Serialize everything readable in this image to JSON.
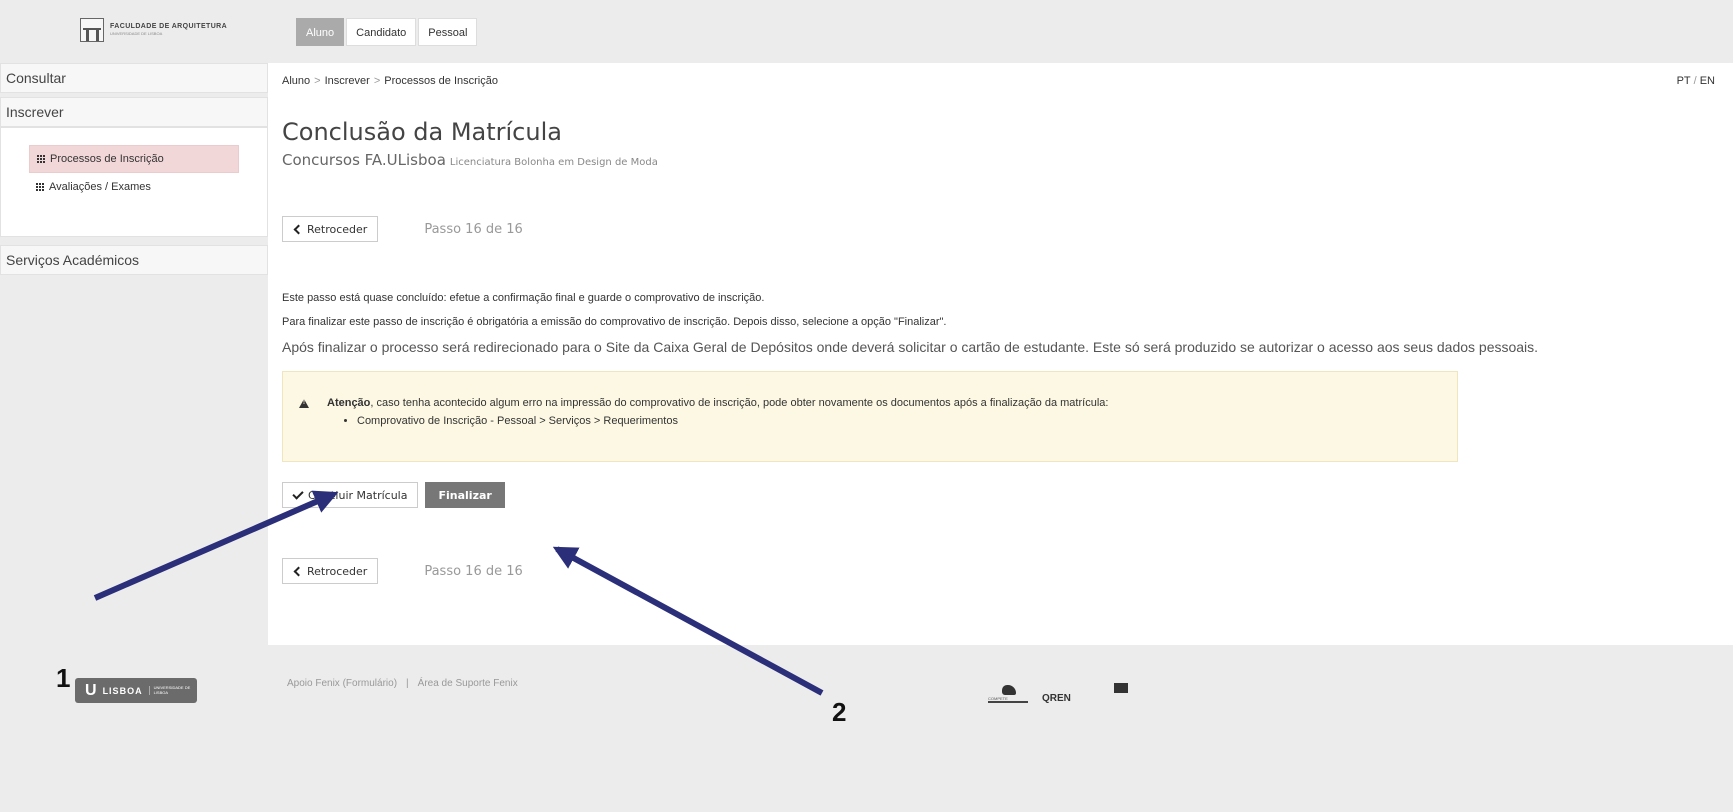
{
  "header": {
    "logo_text": "FACULDADE DE ARQUITETURA",
    "logo_subtext": "UNIVERSIDADE DE LISBOA",
    "tabs": [
      {
        "label": "Aluno",
        "active": true
      },
      {
        "label": "Candidato",
        "active": false
      },
      {
        "label": "Pessoal",
        "active": false
      }
    ]
  },
  "sidebar": {
    "consultar": "Consultar",
    "inscrever": "Inscrever",
    "items": [
      {
        "label": "Processos de Inscrição",
        "icon": "grid-icon",
        "active": true
      },
      {
        "label": "Avaliações / Exames",
        "icon": "grid-icon",
        "active": false
      }
    ],
    "servicos": "Serviços Académicos"
  },
  "breadcrumb": {
    "items": [
      "Aluno",
      "Inscrever",
      "Processos de Inscrição"
    ],
    "separator": ">"
  },
  "language": {
    "pt": "PT",
    "en": "EN",
    "separator": "/"
  },
  "page": {
    "title": "Conclusão da Matrícula",
    "subtitle": "Concursos FA.ULisboa",
    "subtitle_small": "Licenciatura Bolonha em Design de Moda"
  },
  "steps": {
    "back_label": "Retroceder",
    "step_label": "Passo 16 de 16"
  },
  "body": {
    "p1": "Este passo está quase concluído: efetue a confirmação final e guarde o comprovativo de inscrição.",
    "p2": "Para finalizar este passo de inscrição é obrigatória a emissão do comprovativo de inscrição. Depois disso, selecione a opção \"Finalizar\".",
    "p3": "Após finalizar o processo será redirecionado para o Site da Caixa Geral de Depósitos onde deverá solicitar o cartão de estudante. Este só será produzido se autorizar o acesso aos seus dados pessoais."
  },
  "alert": {
    "bold": "Atenção",
    "text": ", caso tenha acontecido algum erro na impressão do comprovativo de inscrição, pode obter novamente os documentos após a finalização da matrícula:",
    "list": [
      "Comprovativo de Inscrição - Pessoal > Serviços > Requerimentos"
    ]
  },
  "actions": {
    "concluir": "Concluir Matrícula",
    "finalizar": "Finalizar"
  },
  "footer": {
    "ulisboa_logo": "LISBOA",
    "ulisboa_sub": "UNIVERSIDADE DE LISBOA",
    "link1": "Apoio Fenix (Formulário)",
    "separator": "|",
    "link2": "Área de Suporte Fenix",
    "sponsor1": "COMPETE",
    "sponsor2": "QREN"
  },
  "annotations": {
    "label1": "1",
    "label2": "2",
    "arrow_color": "#2b2f7a"
  },
  "colors": {
    "active_tab": "#aaaaaa",
    "active_sidebar": "#f2d7d9",
    "alert_bg": "#fcf8e3",
    "primary_button": "#777777"
  }
}
